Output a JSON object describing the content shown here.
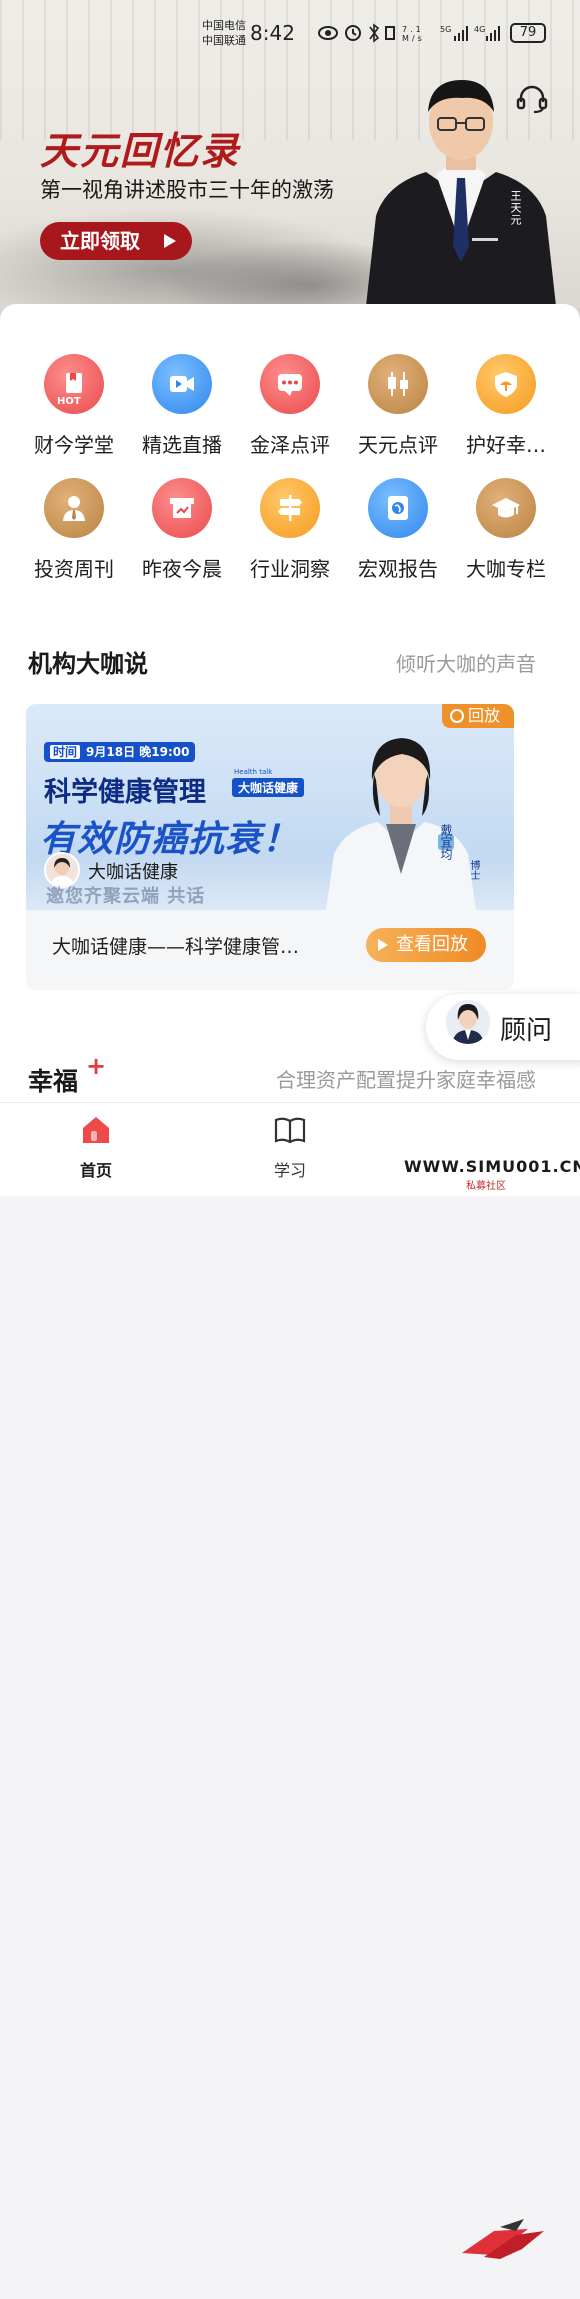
{
  "status_bar": {
    "carrier_1": "中国电信",
    "carrier_2": "中国联通",
    "time": "8:42",
    "speed": "7.1 M/s",
    "battery": "79"
  },
  "banner": {
    "title": "天元回忆录",
    "subtitle": "第一视角讲述股市三十年的激荡",
    "cta": "立即领取",
    "person_name": "王天元"
  },
  "categories": [
    {
      "label": "财今学堂",
      "icon": "book-icon",
      "badge": "HOT"
    },
    {
      "label": "精选直播",
      "icon": "video-camera-icon"
    },
    {
      "label": "金泽点评",
      "icon": "chat-bubble-icon"
    },
    {
      "label": "天元点评",
      "icon": "candlestick-icon"
    },
    {
      "label": "护好幸…",
      "icon": "umbrella-icon"
    },
    {
      "label": "投资周刊",
      "icon": "businessman-icon"
    },
    {
      "label": "昨夜今晨",
      "icon": "calendar-chart-icon"
    },
    {
      "label": "行业洞察",
      "icon": "signpost-icon"
    },
    {
      "label": "宏观报告",
      "icon": "globe-icon"
    },
    {
      "label": "大咖专栏",
      "icon": "graduation-cap-icon"
    }
  ],
  "section": {
    "title": "机构大咖说",
    "subtitle": "倾听大咖的声音"
  },
  "live_card": {
    "replay_badge": "回放",
    "time_tag": "时间",
    "time_text": "9月18日 晚19:00",
    "headline": "科学健康管理",
    "headline_tag": "大咖话健康",
    "headline_en": "Health talk",
    "main_slogan": "有效防癌抗衰！",
    "host_name": "大咖话健康",
    "faded_text": "邀您齐聚云端  共话",
    "speaker_name": "戴宜均",
    "speaker_title": "博士",
    "description": "大咖话健康——科学健康管…",
    "replay_button": "查看回放"
  },
  "advisor": {
    "label": "顾问"
  },
  "happy_section": {
    "title": "幸福",
    "plus": "+",
    "subtitle": "合理资产配置提升家庭幸福感"
  },
  "tabs": [
    {
      "label": "首页",
      "active": true
    },
    {
      "label": "学习",
      "active": false
    }
  ],
  "watermark": {
    "text": "WWW.SIMU001.CN",
    "sub": "私募社区"
  },
  "colors": {
    "brand_red": "#a8171b",
    "accent_orange": "#f08a24",
    "blue": "#1552c9"
  }
}
